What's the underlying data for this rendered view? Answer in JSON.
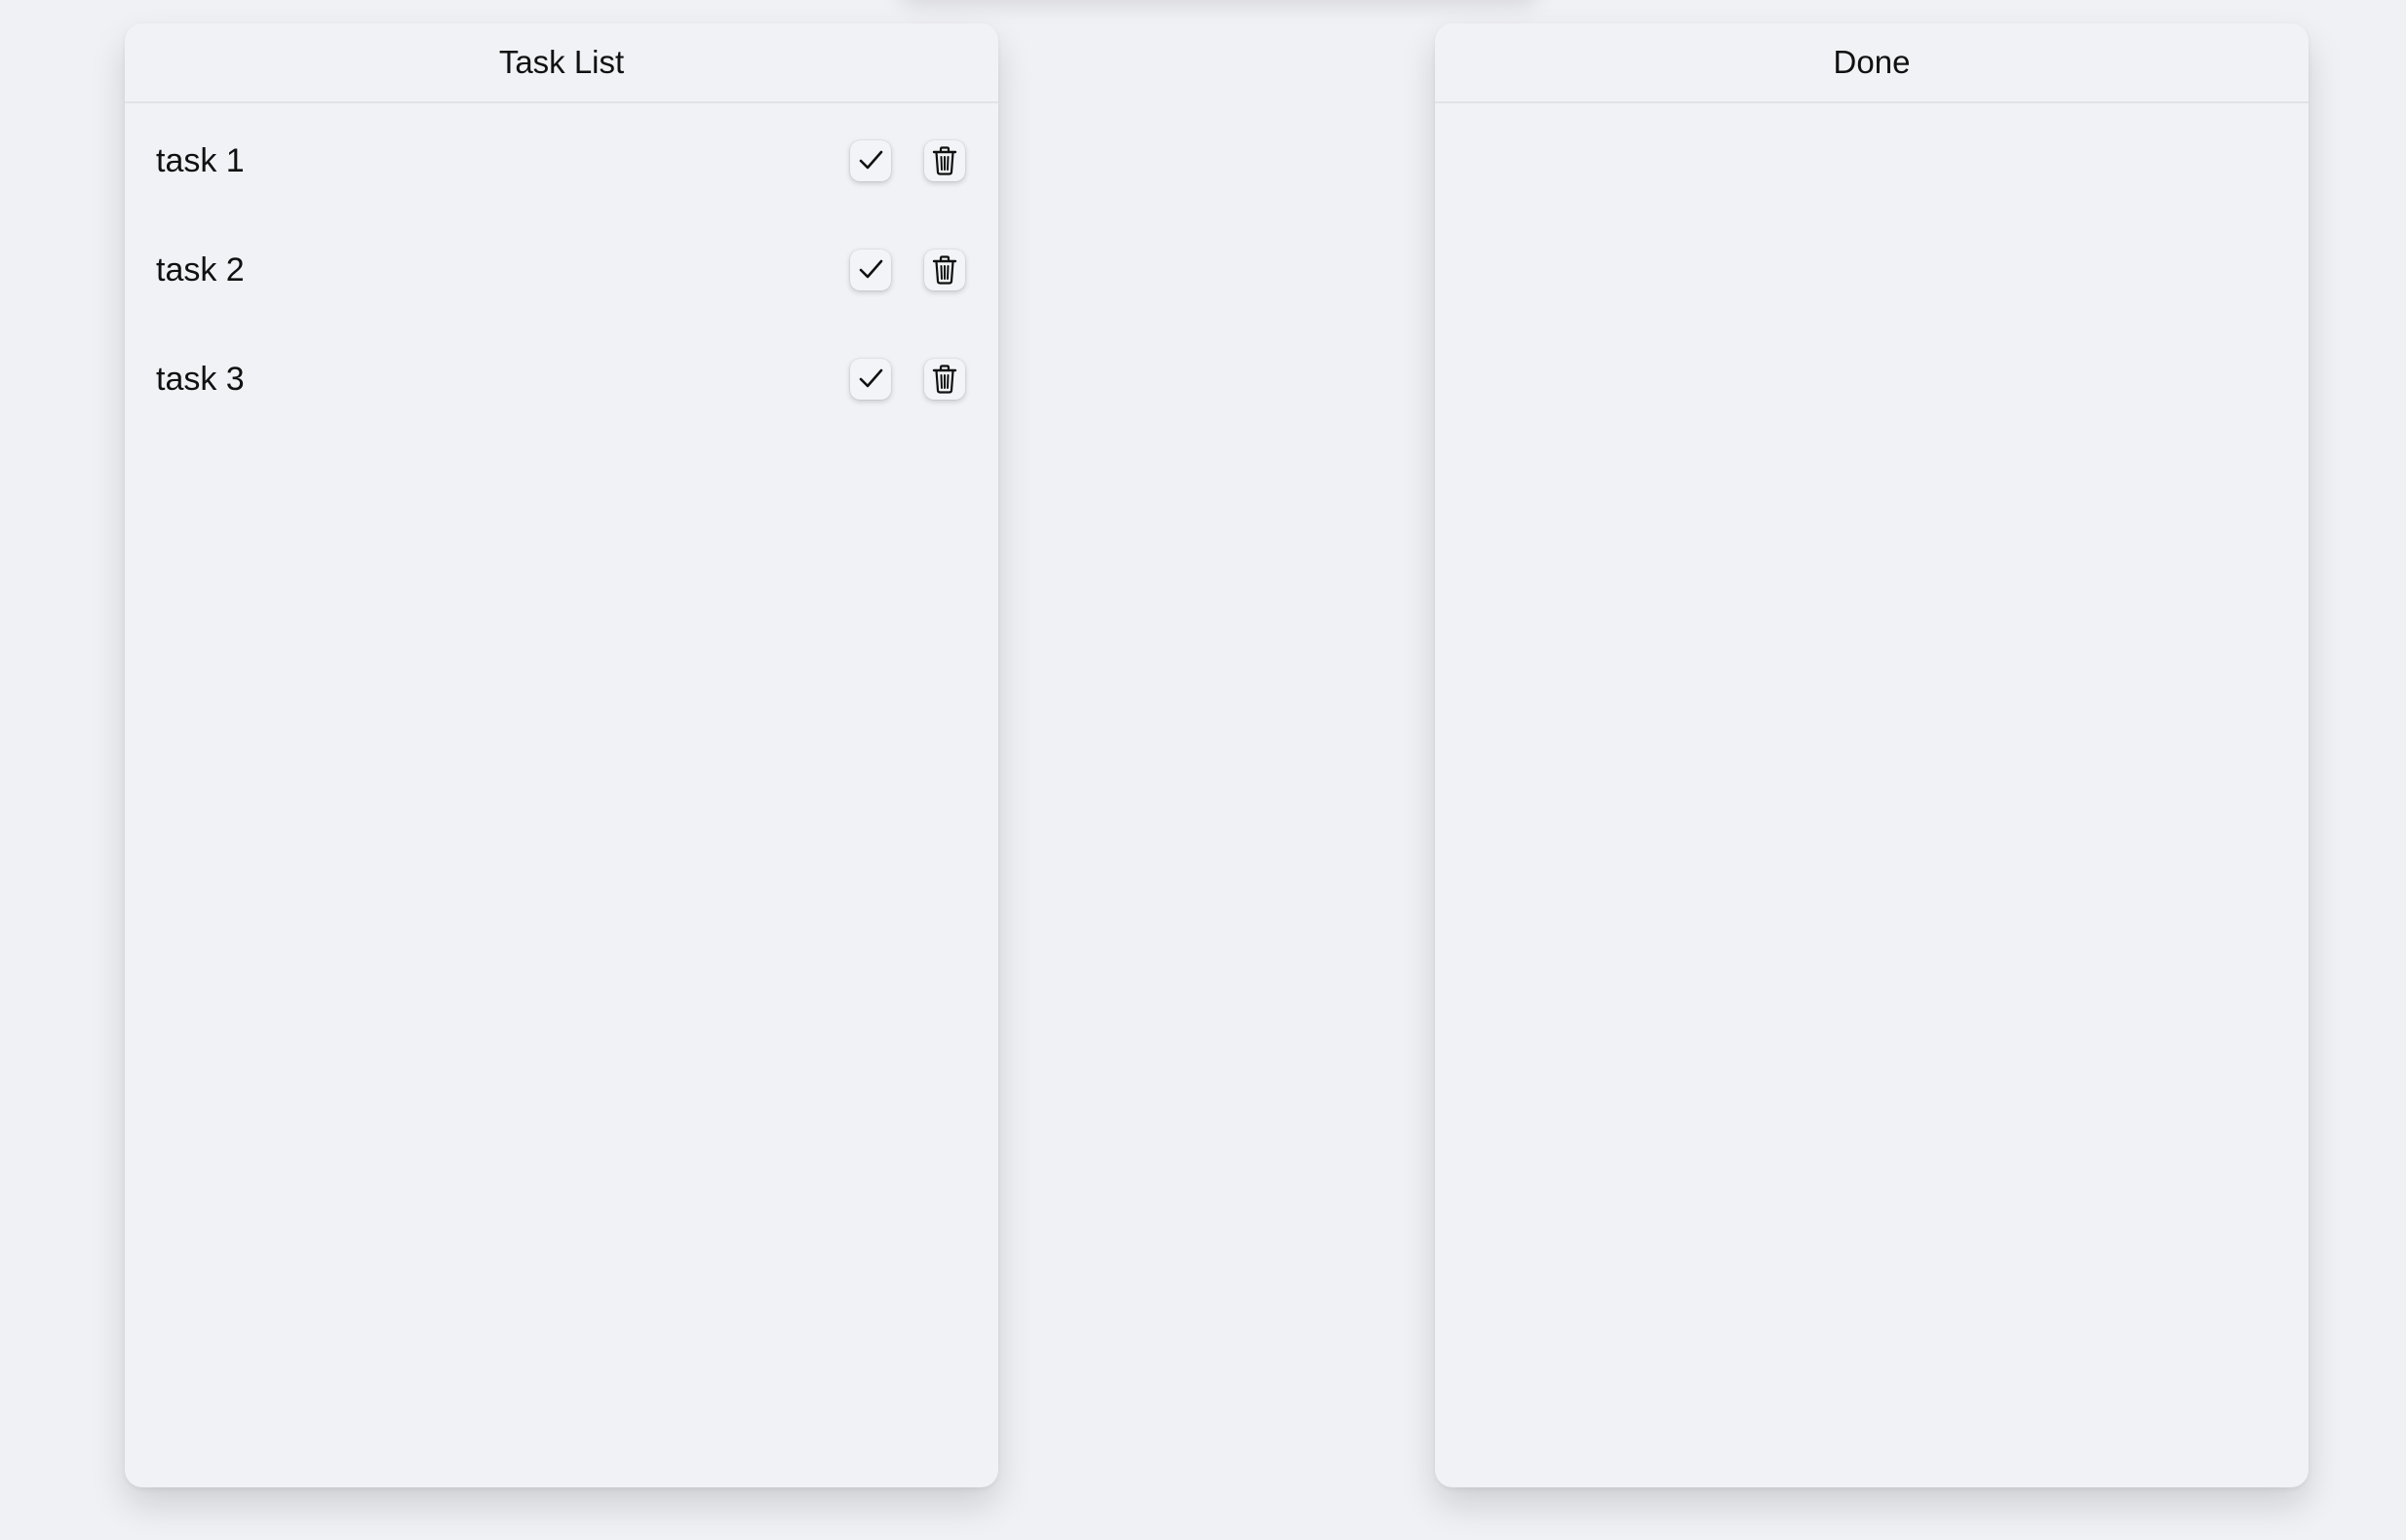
{
  "columns": {
    "todo": {
      "title": "Task List",
      "tasks": [
        {
          "label": "task 1"
        },
        {
          "label": "task 2"
        },
        {
          "label": "task 3"
        }
      ]
    },
    "done": {
      "title": "Done",
      "tasks": []
    }
  },
  "icons": {
    "complete": "checkmark-icon",
    "delete": "trash-icon"
  }
}
